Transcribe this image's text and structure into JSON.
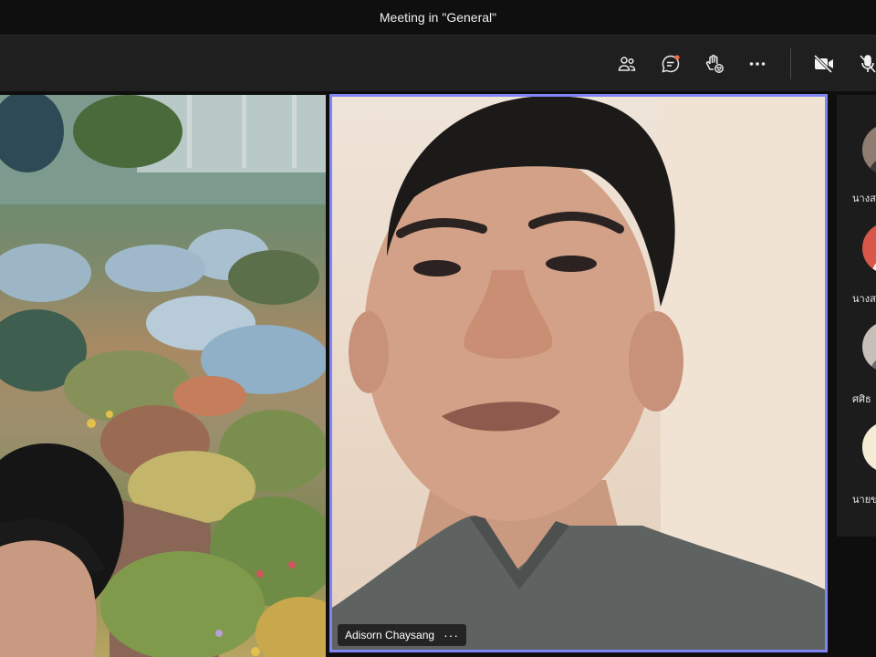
{
  "window": {
    "title": "Meeting in \"General\""
  },
  "toolbar": {
    "buttons": [
      {
        "icon": "people-icon"
      },
      {
        "icon": "chat-icon"
      },
      {
        "icon": "raise-hand-icon"
      },
      {
        "icon": "more-options-icon"
      },
      {
        "icon": "camera-off-icon"
      },
      {
        "icon": "mic-off-icon"
      }
    ],
    "colors": {
      "accent_dot": "#f06b4a"
    }
  },
  "speaker": {
    "name": "Adisorn Chaysang",
    "more": "···",
    "highlight_color": "#7f85f5"
  },
  "roster": {
    "participants": [
      {
        "name": "นางส"
      },
      {
        "name": "นางส"
      },
      {
        "name": "ศศิธ"
      },
      {
        "name": "นายข"
      }
    ]
  }
}
